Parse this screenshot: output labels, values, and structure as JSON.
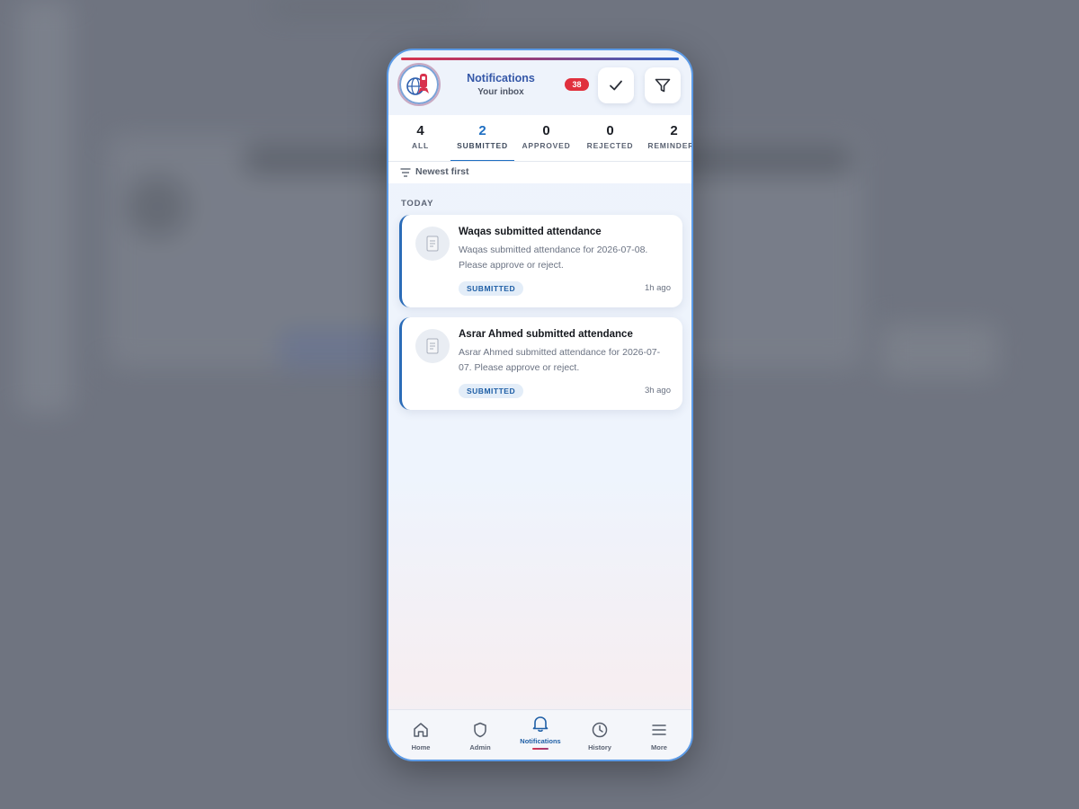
{
  "header": {
    "title": "Notifications",
    "subtitle": "Your inbox",
    "badge_count": "38",
    "mark_all_icon": "check-icon",
    "filter_icon": "funnel-icon",
    "logo_icon": "company-logo"
  },
  "tabs": [
    {
      "count": "4",
      "label": "ALL",
      "active": false
    },
    {
      "count": "2",
      "label": "SUBMITTED",
      "active": true
    },
    {
      "count": "0",
      "label": "APPROVED",
      "active": false
    },
    {
      "count": "0",
      "label": "REJECTED",
      "active": false
    },
    {
      "count": "2",
      "label": "REMINDERS",
      "active": false
    }
  ],
  "sort": {
    "label": "Newest first",
    "icon": "sort-lines-icon"
  },
  "section": {
    "label": "TODAY"
  },
  "notifications": [
    {
      "title": "Waqas submitted attendance",
      "body": "Waqas submitted attendance for 2026-07-08. Please approve or reject.",
      "status": "SUBMITTED",
      "time": "1h ago",
      "icon": "document-icon"
    },
    {
      "title": "Asrar Ahmed submitted attendance",
      "body": "Asrar Ahmed submitted attendance for 2026-07-07. Please approve or reject.",
      "status": "SUBMITTED",
      "time": "3h ago",
      "icon": "document-icon"
    }
  ],
  "bottom_nav": [
    {
      "label": "Home",
      "icon": "home-icon",
      "active": false
    },
    {
      "label": "Admin",
      "icon": "shield-icon",
      "active": false
    },
    {
      "label": "Notifications",
      "icon": "bell-icon",
      "active": true
    },
    {
      "label": "History",
      "icon": "clock-icon",
      "active": false
    },
    {
      "label": "More",
      "icon": "menu-icon",
      "active": false
    }
  ],
  "colors": {
    "accent": "#1f6fc2",
    "badge": "#e0303d",
    "frame": "#5b9ae6",
    "backdrop": "#6f7480"
  }
}
